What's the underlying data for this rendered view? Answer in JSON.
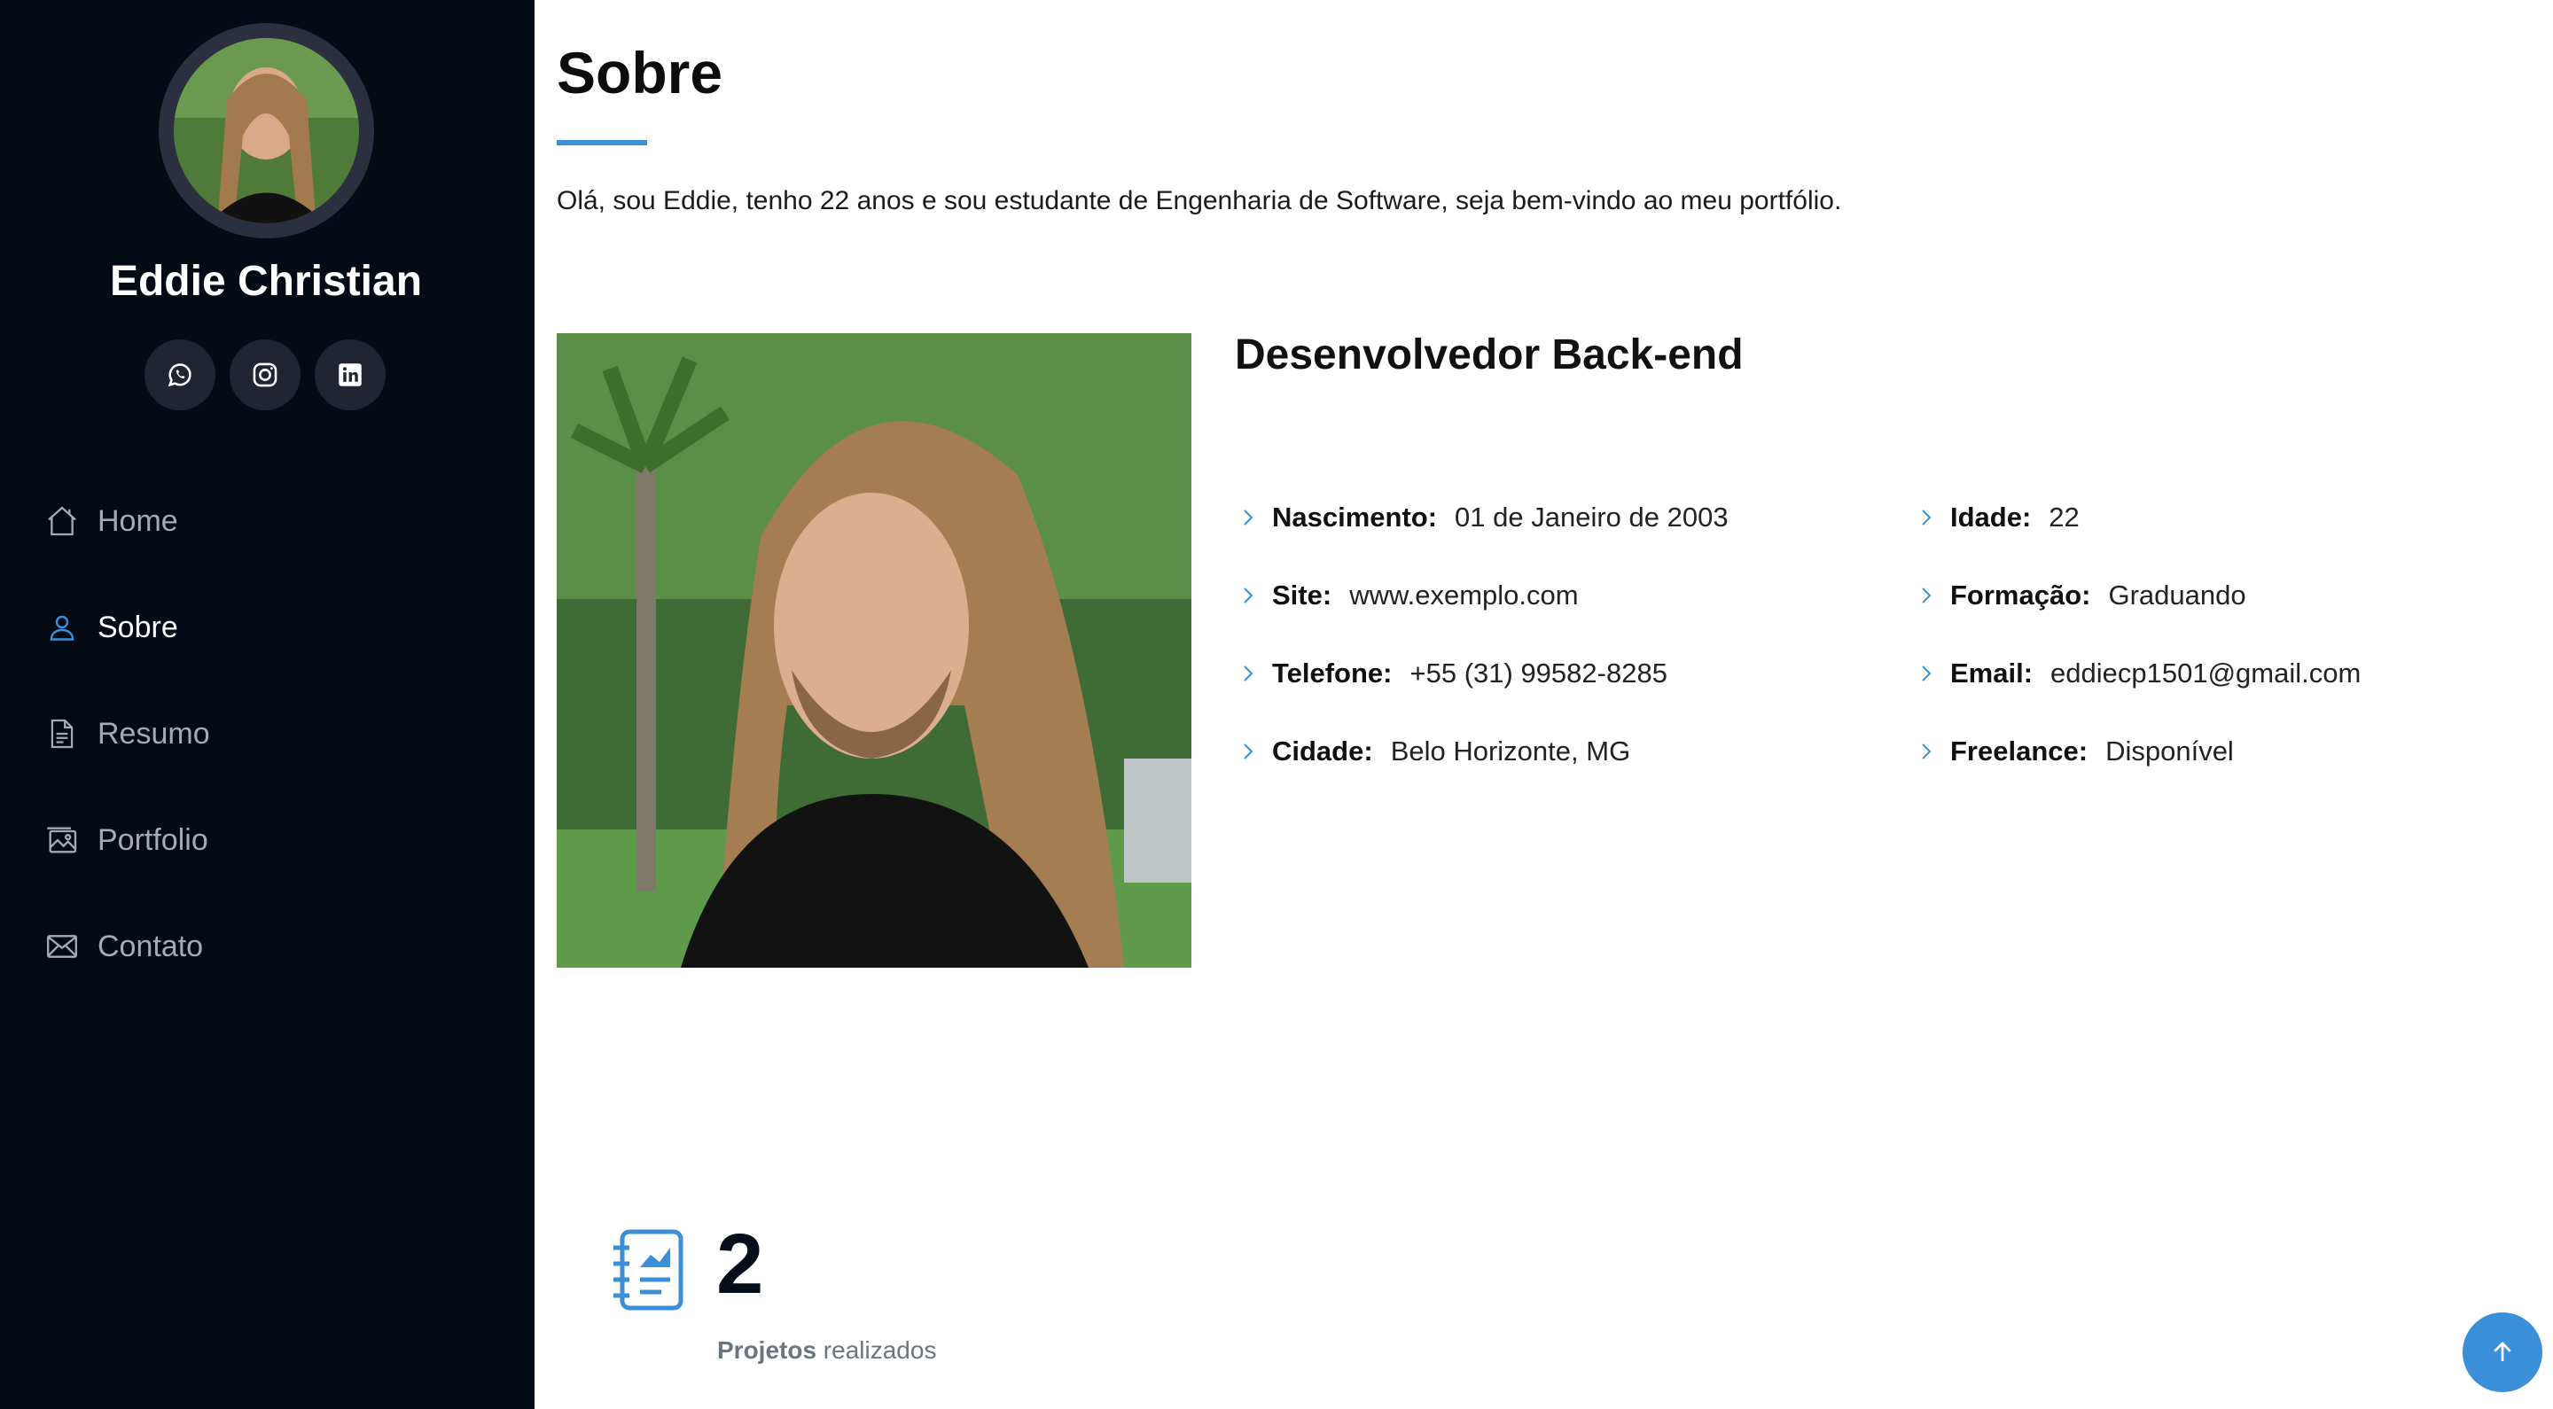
{
  "profile": {
    "name": "Eddie Christian",
    "socials": [
      "whatsapp-icon",
      "instagram-icon",
      "linkedin-icon"
    ]
  },
  "nav": {
    "items": [
      {
        "label": "Home",
        "icon": "home-icon"
      },
      {
        "label": "Sobre",
        "icon": "person-icon",
        "active": true
      },
      {
        "label": "Resumo",
        "icon": "file-text-icon"
      },
      {
        "label": "Portfolio",
        "icon": "images-icon"
      },
      {
        "label": "Contato",
        "icon": "envelope-icon"
      }
    ]
  },
  "about": {
    "title": "Sobre",
    "intro": "Olá, sou Eddie, tenho 22 anos e sou estudante de Engenharia de Software, seja bem-vindo ao meu portfólio.",
    "role": "Desenvolvedor Back-end",
    "left": [
      {
        "key": "Nascimento:",
        "value": "01 de Janeiro de 2003"
      },
      {
        "key": "Site:",
        "value": "www.exemplo.com"
      },
      {
        "key": "Telefone:",
        "value": "+55 (31) 99582-8285"
      },
      {
        "key": "Cidade:",
        "value": "Belo Horizonte, MG"
      }
    ],
    "right": [
      {
        "key": "Idade:",
        "value": "22"
      },
      {
        "key": "Formação:",
        "value": "Graduando"
      },
      {
        "key": "Email:",
        "value": "eddiecp1501@gmail.com"
      },
      {
        "key": "Freelance:",
        "value": "Disponível"
      }
    ]
  },
  "stats": {
    "number": "2",
    "label_bold": "Projetos",
    "label_rest": " realizados"
  },
  "colors": {
    "sidebar_bg": "#040b14",
    "accent": "#3a8fd8"
  }
}
